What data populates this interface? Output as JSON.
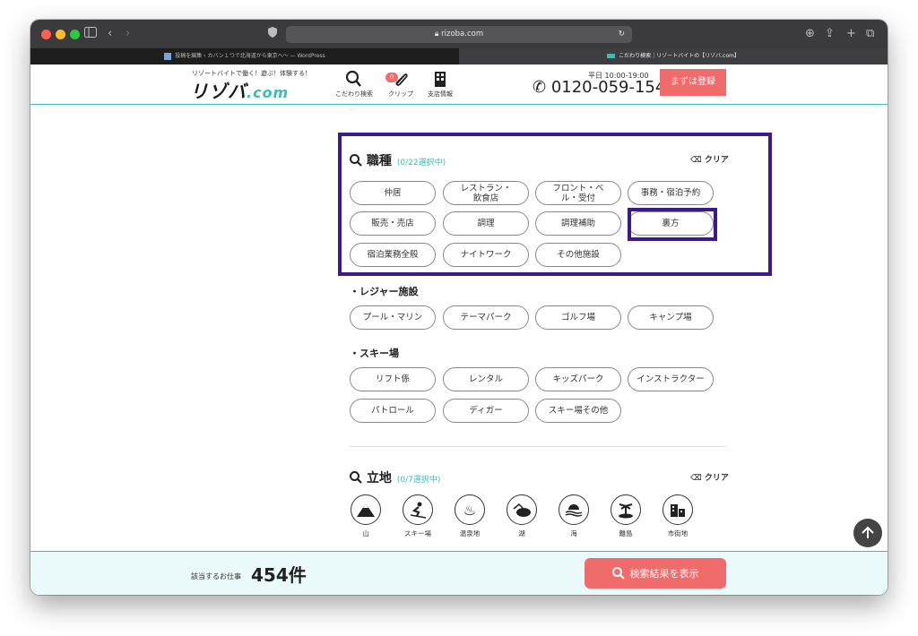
{
  "browser": {
    "url": "rizoba.com",
    "tabs": [
      {
        "title": "投稿を編集 ‹ カバン１つで北海道から東京へ〜 — WordPress"
      },
      {
        "title": "こだわり検索｜リゾートバイトの【リゾバ.com】"
      }
    ]
  },
  "header": {
    "tagline": "リゾートバイトで働く！遊ぶ！体験する！",
    "logo_main": "リゾバ",
    "logo_dot": ".com",
    "nav": [
      {
        "label": "こだわり検索",
        "icon": "search-icon"
      },
      {
        "label": "クリップ",
        "icon": "paperclip-icon",
        "badge": "0"
      },
      {
        "label": "支店情報",
        "icon": "building-icon"
      }
    ],
    "hours": "平日 10:00-19:00",
    "phone": "0120-059-154",
    "register_label": "まずは登録"
  },
  "job_section": {
    "title": "職種",
    "count": "(0/22選択中)",
    "clear_label": "クリア",
    "chips": [
      "仲居",
      "レストラン・飲食店",
      "フロント・ベル・受付",
      "事務・宿泊予約",
      "販売・売店",
      "調理",
      "調理補助",
      "裏方",
      "宿泊業務全般",
      "ナイトワーク",
      "その他施設"
    ],
    "leisure_title": "・レジャー施設",
    "leisure_chips": [
      "プール・マリン",
      "テーマパーク",
      "ゴルフ場",
      "キャンプ場"
    ],
    "ski_title": "・スキー場",
    "ski_chips": [
      "リフト係",
      "レンタル",
      "キッズパーク",
      "インストラクター",
      "パトロール",
      "ディガー",
      "スキー場その他"
    ]
  },
  "location_section": {
    "title": "立地",
    "count": "(0/7選択中)",
    "clear_label": "クリア",
    "items": [
      {
        "label": "山",
        "icon": "mountain-icon"
      },
      {
        "label": "スキー場",
        "icon": "skier-icon"
      },
      {
        "label": "温泉地",
        "icon": "hot-spring-icon"
      },
      {
        "label": "湖",
        "icon": "lake-icon"
      },
      {
        "label": "海",
        "icon": "sunset-sea-icon"
      },
      {
        "label": "離島",
        "icon": "island-icon"
      },
      {
        "label": "市街地",
        "icon": "city-icon"
      }
    ]
  },
  "footer": {
    "jobs_label": "該当するお仕事",
    "jobs_count": "454件",
    "search_button": "検索結果を表示"
  },
  "colors": {
    "accent": "#3dbcb6",
    "cta": "#f06b6b",
    "highlight_box": "#3d1a8c"
  }
}
